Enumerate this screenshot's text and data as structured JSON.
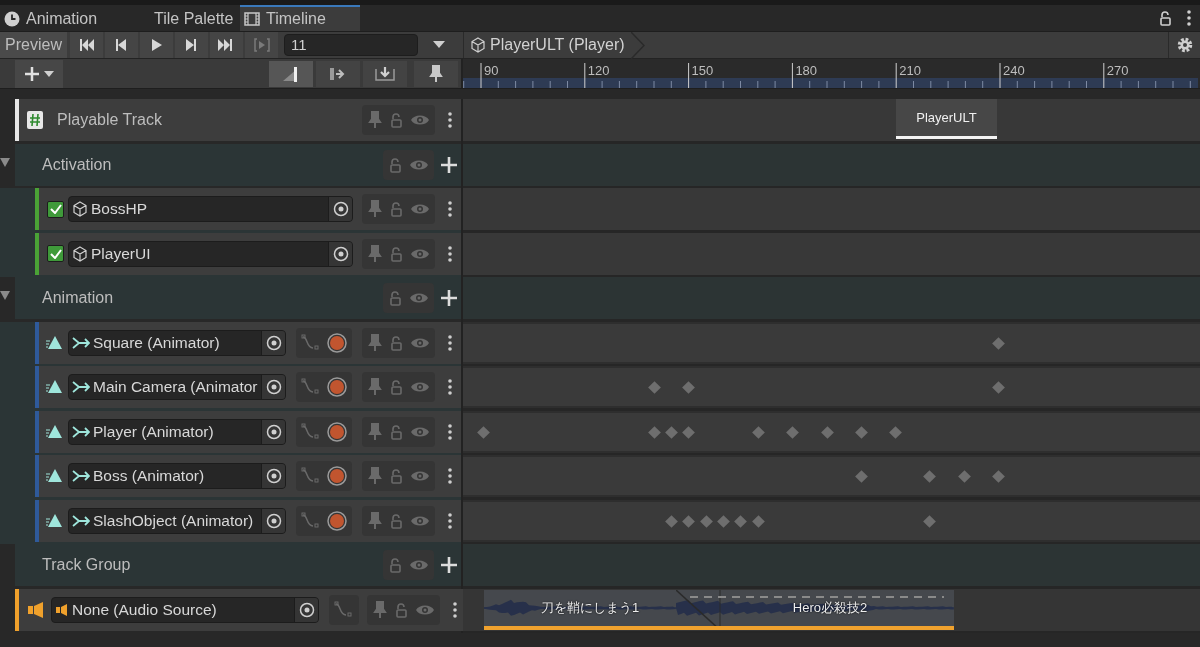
{
  "tabs": [
    {
      "label": "Animation",
      "selected": false
    },
    {
      "label": "Tile Palette",
      "selected": false
    },
    {
      "label": "Timeline",
      "selected": true
    }
  ],
  "toolbar": {
    "preview": "Preview",
    "frame": "11",
    "breadcrumb": "PlayerULT (Player)"
  },
  "edit_modes": [
    {
      "selected": true
    },
    {
      "selected": false
    },
    {
      "selected": false
    }
  ],
  "ruler": [
    "90",
    "120",
    "150",
    "180",
    "210",
    "240",
    "270"
  ],
  "tracks": [
    {
      "kind": "playable",
      "name": "Playable Track",
      "clips": [
        {
          "label": "PlayerULT"
        }
      ]
    },
    {
      "kind": "group",
      "name": "Activation",
      "expanded": true,
      "children": [
        {
          "kind": "activation",
          "name": "BossHP",
          "checked": true
        },
        {
          "kind": "activation",
          "name": "PlayerUI",
          "checked": true
        }
      ]
    },
    {
      "kind": "group",
      "name": "Animation",
      "expanded": true,
      "children": [
        {
          "kind": "animation",
          "name": "Square (Animator)"
        },
        {
          "kind": "animation",
          "name": "Main Camera (Animator"
        },
        {
          "kind": "animation",
          "name": "Player (Animator)"
        },
        {
          "kind": "animation",
          "name": "Boss (Animator)"
        },
        {
          "kind": "animation",
          "name": "SlashObject (Animator)"
        }
      ]
    },
    {
      "kind": "group",
      "name": "Track Group"
    },
    {
      "kind": "audio",
      "name": "None (Audio Source)",
      "clips": [
        {
          "label": "刀を鞘にしまう1"
        },
        {
          "label": "Hero必殺技2"
        }
      ]
    }
  ]
}
